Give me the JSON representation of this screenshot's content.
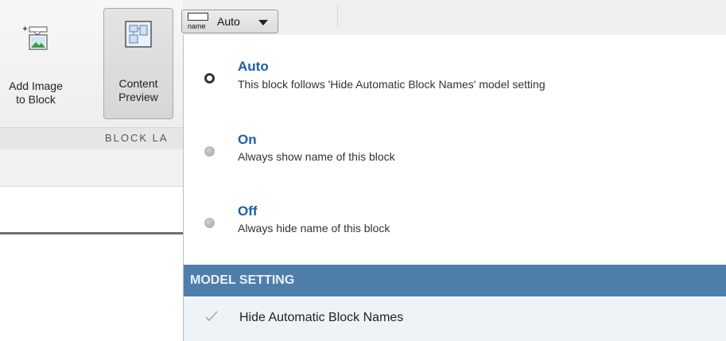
{
  "ribbon": {
    "add_image_button": {
      "line1": "Add Image",
      "line2": "to Block",
      "icon": "add-image-icon"
    },
    "content_preview_button": {
      "line1": "Content",
      "line2": "Preview",
      "icon": "content-preview-icon"
    },
    "group_label": "BLOCK LA",
    "name_dropdown": {
      "icon": "name-icon",
      "icon_text": "name",
      "value": "Auto",
      "caret": "chevron-down-icon"
    }
  },
  "menu": {
    "options": [
      {
        "title": "Auto",
        "description": "This block follows 'Hide Automatic Block Names' model setting",
        "selected": true
      },
      {
        "title": "On",
        "description": "Always show name of this block",
        "selected": false
      },
      {
        "title": "Off",
        "description": "Always hide name of this block",
        "selected": false
      }
    ],
    "section_header": "MODEL SETTING",
    "model_setting": {
      "label": "Hide Automatic Block Names",
      "checked": true,
      "icon": "checkmark-icon"
    }
  },
  "colors": {
    "accent_title": "#1d5fa6",
    "section_header_bg": "#4f7eab",
    "setting_row_bg": "#eef3f8"
  }
}
